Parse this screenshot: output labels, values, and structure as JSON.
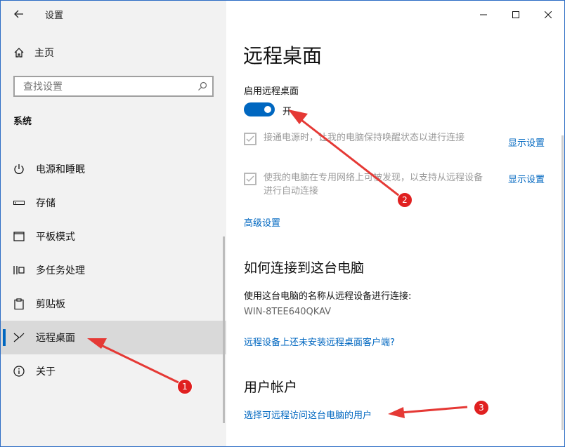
{
  "window": {
    "title": "设置",
    "controls": [
      "minimize",
      "maximize",
      "close"
    ]
  },
  "sidebar": {
    "home_label": "主页",
    "search_placeholder": "查找设置",
    "section_label": "系统",
    "items": [
      {
        "label": "电源和睡眠",
        "icon": "power-icon"
      },
      {
        "label": "存储",
        "icon": "storage-icon"
      },
      {
        "label": "平板模式",
        "icon": "tablet-icon"
      },
      {
        "label": "多任务处理",
        "icon": "multitask-icon"
      },
      {
        "label": "剪贴板",
        "icon": "clipboard-icon"
      },
      {
        "label": "远程桌面",
        "icon": "remote-desktop-icon",
        "selected": true
      },
      {
        "label": "关于",
        "icon": "info-icon"
      }
    ]
  },
  "main": {
    "title": "远程桌面",
    "enable_label": "启用远程桌面",
    "toggle": {
      "on": true,
      "state_text": "开"
    },
    "options": [
      {
        "text": "接通电源时，让我的电脑保持唤醒状态以进行连接",
        "checked": true,
        "link": "显示设置"
      },
      {
        "text_line1": "使我的电脑在专用网络上可被发现，以支持从远程设备",
        "text_line2": "进行自动连接",
        "checked": true,
        "link": "显示设置"
      }
    ],
    "advanced_link": "高级设置",
    "connect_heading": "如何连接到这台电脑",
    "connect_desc": "使用这台电脑的名称从远程设备进行连接:",
    "pc_name": "WIN-8TEE640QKAV",
    "no_client_link": "远程设备上还未安装远程桌面客户端?",
    "accounts_heading": "用户帐户",
    "select_users_link": "选择可远程访问这台电脑的用户"
  },
  "annotations": {
    "badges": [
      "1",
      "2",
      "3"
    ],
    "color": "#e53935"
  },
  "colors": {
    "accent": "#0067c0",
    "sidebar_bg": "#f2f2f2",
    "selected_bg": "#d9d9d9"
  }
}
